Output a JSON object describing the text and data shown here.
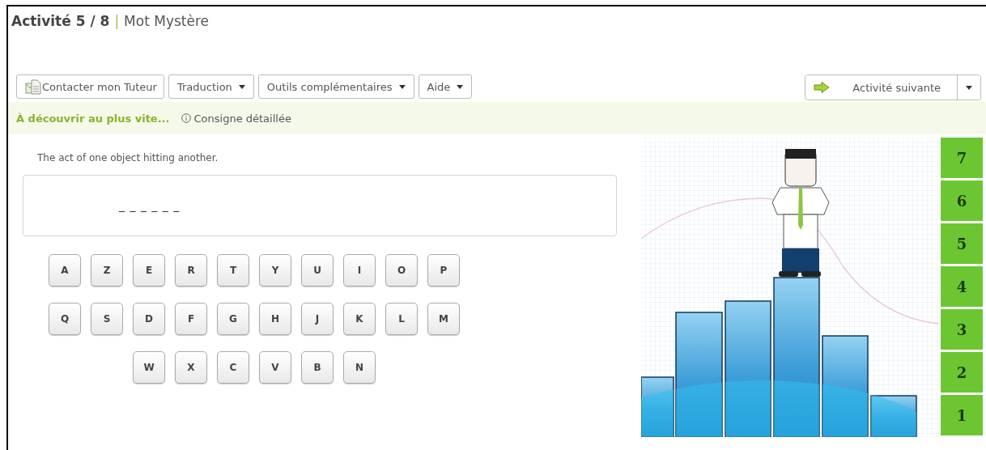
{
  "header": {
    "activity": "Activité 5 / 8",
    "separator": "|",
    "title": "Mot Mystère"
  },
  "toolbar": {
    "buttons": [
      {
        "label": "Contacter mon Tuteur",
        "kind": "contact"
      },
      {
        "label": "Traduction",
        "kind": "dropdown"
      },
      {
        "label": "Outils complémentaires",
        "kind": "dropdown"
      },
      {
        "label": "Aide",
        "kind": "dropdown"
      }
    ],
    "next": {
      "label": "Activité suivante"
    }
  },
  "instruction_bar": {
    "headline": "À découvrir au plus vite...",
    "link": "Consigne détaillée"
  },
  "clue": "The act of one object hitting another.",
  "answer": {
    "blanks": "_ _ _ _ _ _"
  },
  "keyboard": {
    "rows": [
      [
        "A",
        "Z",
        "E",
        "R",
        "T",
        "Y",
        "U",
        "I",
        "O",
        "P"
      ],
      [
        "Q",
        "S",
        "D",
        "F",
        "G",
        "H",
        "J",
        "K",
        "L",
        "M"
      ],
      [
        "",
        "",
        "W",
        "X",
        "C",
        "V",
        "B",
        "N",
        "",
        ""
      ]
    ]
  },
  "levels": [
    "7",
    "6",
    "5",
    "4",
    "3",
    "2",
    "1"
  ]
}
